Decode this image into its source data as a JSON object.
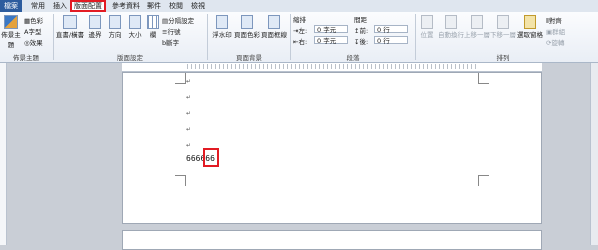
{
  "tabs": [
    "檔案",
    "常用",
    "插入",
    "版面配置",
    "參考資料",
    "郵件",
    "校閱",
    "檢視"
  ],
  "active_tab": "版面配置",
  "ribbon": {
    "theme": {
      "main": "佈景主題",
      "colors": "色彩",
      "fonts": "字型",
      "effects": "效果",
      "group": "佈景主題"
    },
    "page_setup": {
      "orientation_text": "直書/橫書",
      "margins": "邊界",
      "direction": "方向",
      "size": "大小",
      "columns": "欄",
      "breaks": "分隔設定",
      "line_numbers": "行號",
      "hyphenation": "斷字",
      "group": "版面設定"
    },
    "background": {
      "watermark": "浮水印",
      "page_color": "頁面色彩",
      "page_borders": "頁面框線",
      "group": "頁面背景"
    },
    "paragraph": {
      "indent": "縮排",
      "spacing": "間距",
      "left_label": "左:",
      "left_value": "0 字元",
      "right_label": "右:",
      "right_value": "0 字元",
      "before_label": "前:",
      "before_value": "0 行",
      "after_label": "後:",
      "after_value": "0 行",
      "group": "段落"
    },
    "arrange": {
      "position": "位置",
      "wrap": "自動換行",
      "forward": "上移一層",
      "backward": "下移一層",
      "pane": "選取窗格",
      "align": "對齊",
      "group_btn": "群組",
      "rotate": "旋轉",
      "group": "排列"
    }
  },
  "document": {
    "paragraph_mark": "↵",
    "typed_text": "666666"
  }
}
